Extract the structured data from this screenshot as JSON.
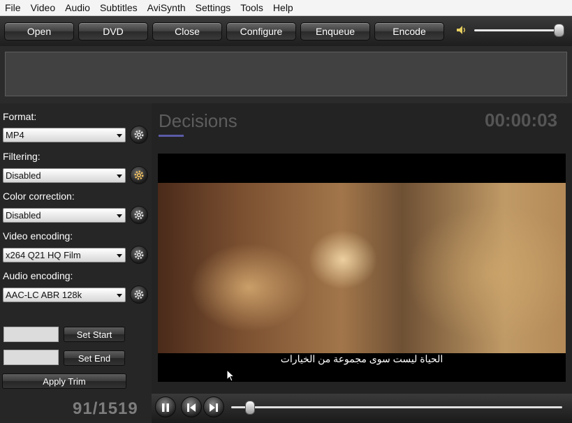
{
  "menu": [
    "File",
    "Video",
    "Audio",
    "Subtitles",
    "AviSynth",
    "Settings",
    "Tools",
    "Help"
  ],
  "toolbar": {
    "open": "Open",
    "dvd": "DVD",
    "close": "Close",
    "configure": "Configure",
    "enqueue": "Enqueue",
    "encode": "Encode",
    "volume_level": 0.98
  },
  "sidebar": {
    "format_label": "Format:",
    "format_value": "MP4",
    "filtering_label": "Filtering:",
    "filtering_value": "Disabled",
    "color_label": "Color correction:",
    "color_value": "Disabled",
    "video_label": "Video encoding:",
    "video_value": "x264 Q21 HQ Film",
    "audio_label": "Audio encoding:",
    "audio_value": "AAC-LC ABR 128k",
    "set_start": "Set Start",
    "set_end": "Set End",
    "apply_trim": "Apply Trim"
  },
  "player": {
    "title": "Decisions",
    "timecode": "00:00:03",
    "subtitle": "الحياة ليست سوى مجموعة من الخيارات",
    "frame_counter": "91/1519",
    "seek_position": 0.06
  },
  "colors": {
    "accent": "#5b5ba8",
    "background": "#2b2b2b"
  }
}
